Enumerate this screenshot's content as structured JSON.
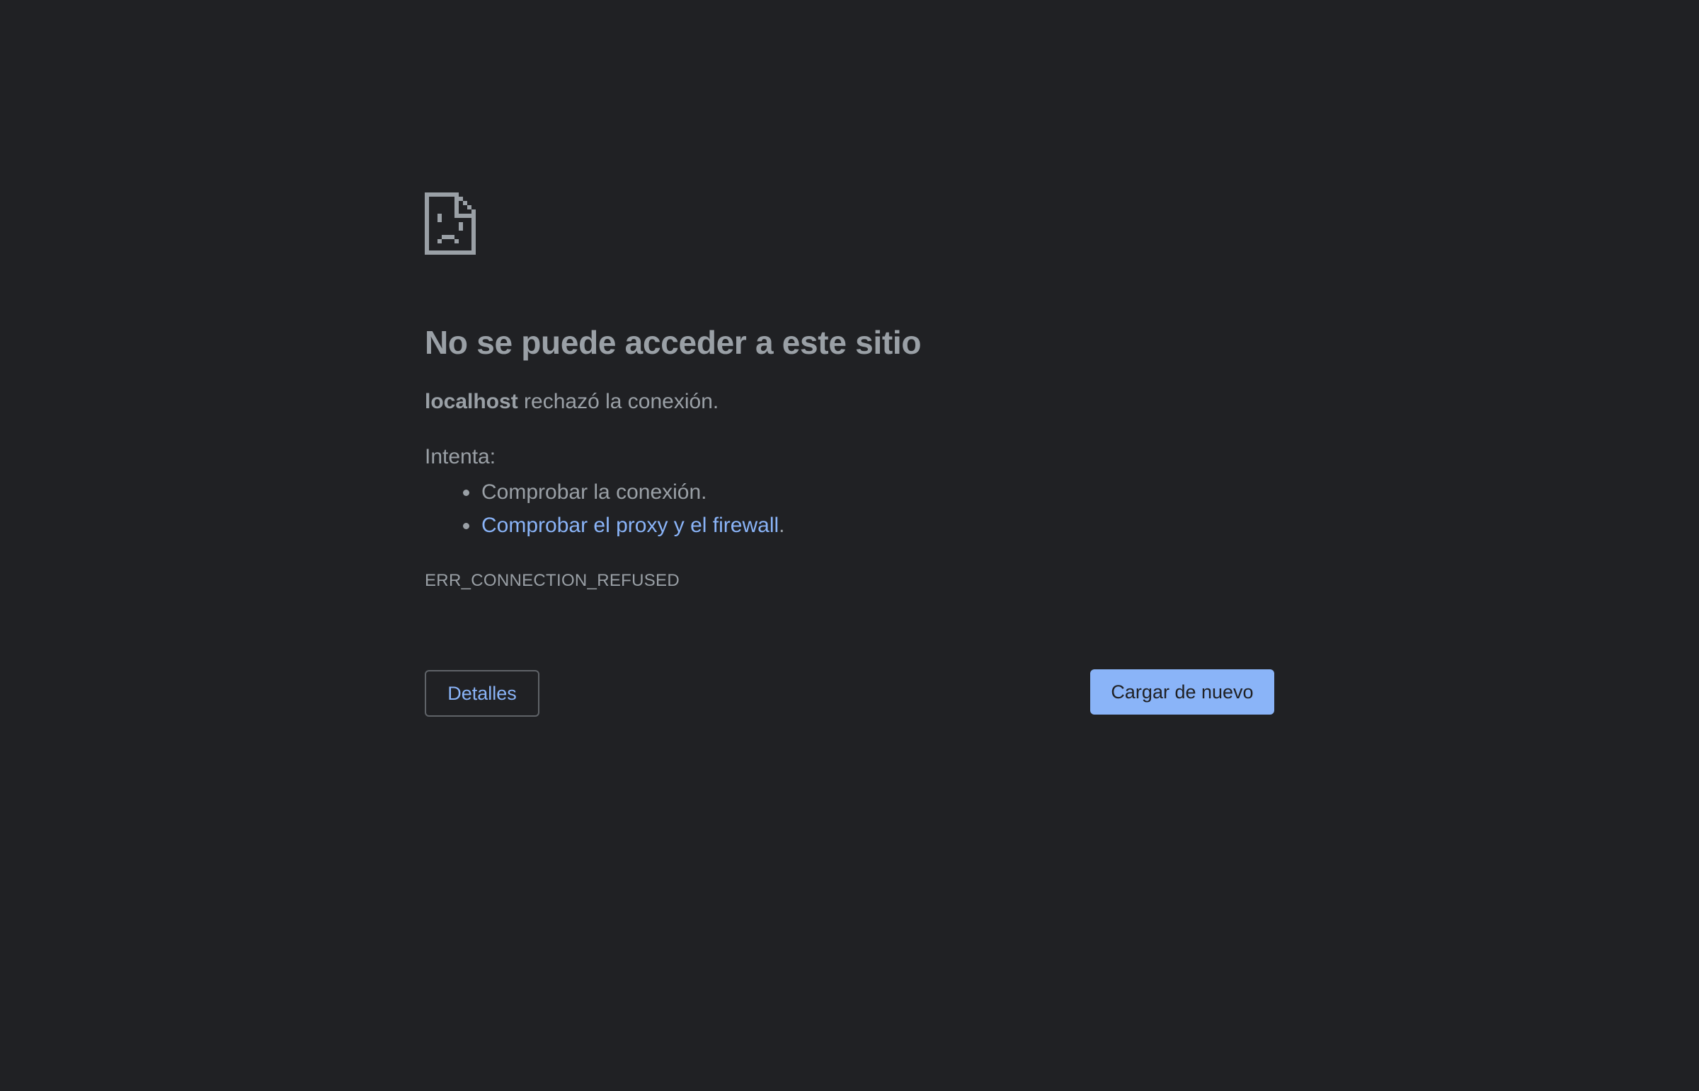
{
  "colors": {
    "background": "#202124",
    "text": "#9aa0a6",
    "link": "#8ab4f8",
    "primary_button": "#8ab4f8",
    "button_border": "#5f6368"
  },
  "icon": "sad-page-icon",
  "heading": "No se puede acceder a este sitio",
  "summary": {
    "host": "localhost",
    "message": " rechazó la conexión."
  },
  "suggestions": {
    "label": "Intenta:",
    "items": [
      {
        "text": "Comprobar la conexión.",
        "link": "",
        "suffix": ""
      },
      {
        "text": "",
        "link": "Comprobar el proxy y el firewall",
        "suffix": "."
      }
    ]
  },
  "error_code": "ERR_CONNECTION_REFUSED",
  "buttons": {
    "details": "Detalles",
    "reload": "Cargar de nuevo"
  }
}
